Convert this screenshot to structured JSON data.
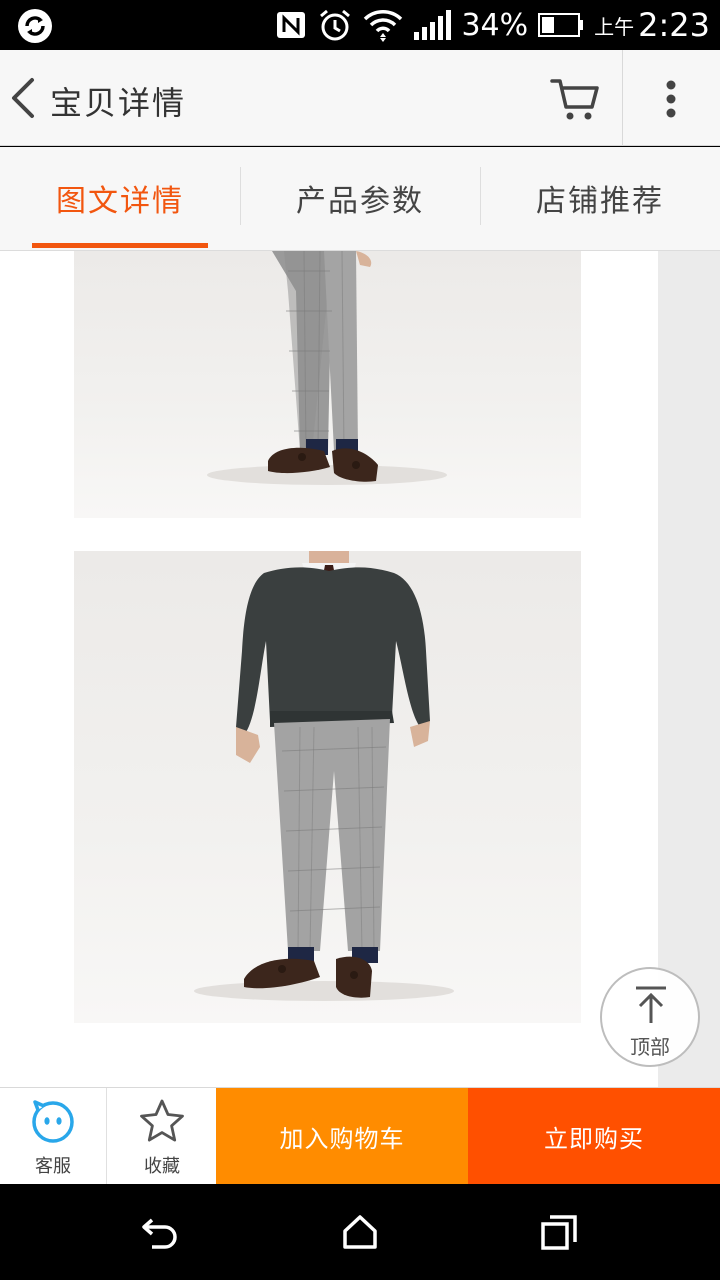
{
  "status_bar": {
    "battery": "34%",
    "ampm": "上午",
    "time": "2:23",
    "icons": [
      "sync-icon",
      "nfc-icon",
      "alarm-icon",
      "wifi-icon",
      "signal-icon",
      "battery-icon"
    ]
  },
  "header": {
    "title": "宝贝详情",
    "icons": [
      "back-icon",
      "cart-icon",
      "more-icon"
    ]
  },
  "tabs": [
    {
      "label": "图文详情",
      "active": true
    },
    {
      "label": "产品参数",
      "active": false
    },
    {
      "label": "店铺推荐",
      "active": false
    }
  ],
  "back_to_top": {
    "label": "顶部"
  },
  "bottom_bar": {
    "service_label": "客服",
    "favorite_label": "收藏",
    "add_cart_label": "加入购物车",
    "buy_now_label": "立即购买"
  },
  "colors": {
    "accent": "#f2560f",
    "add_cart": "#ff8c00",
    "buy_now": "#ff5000",
    "service_icon": "#29a7ea"
  }
}
